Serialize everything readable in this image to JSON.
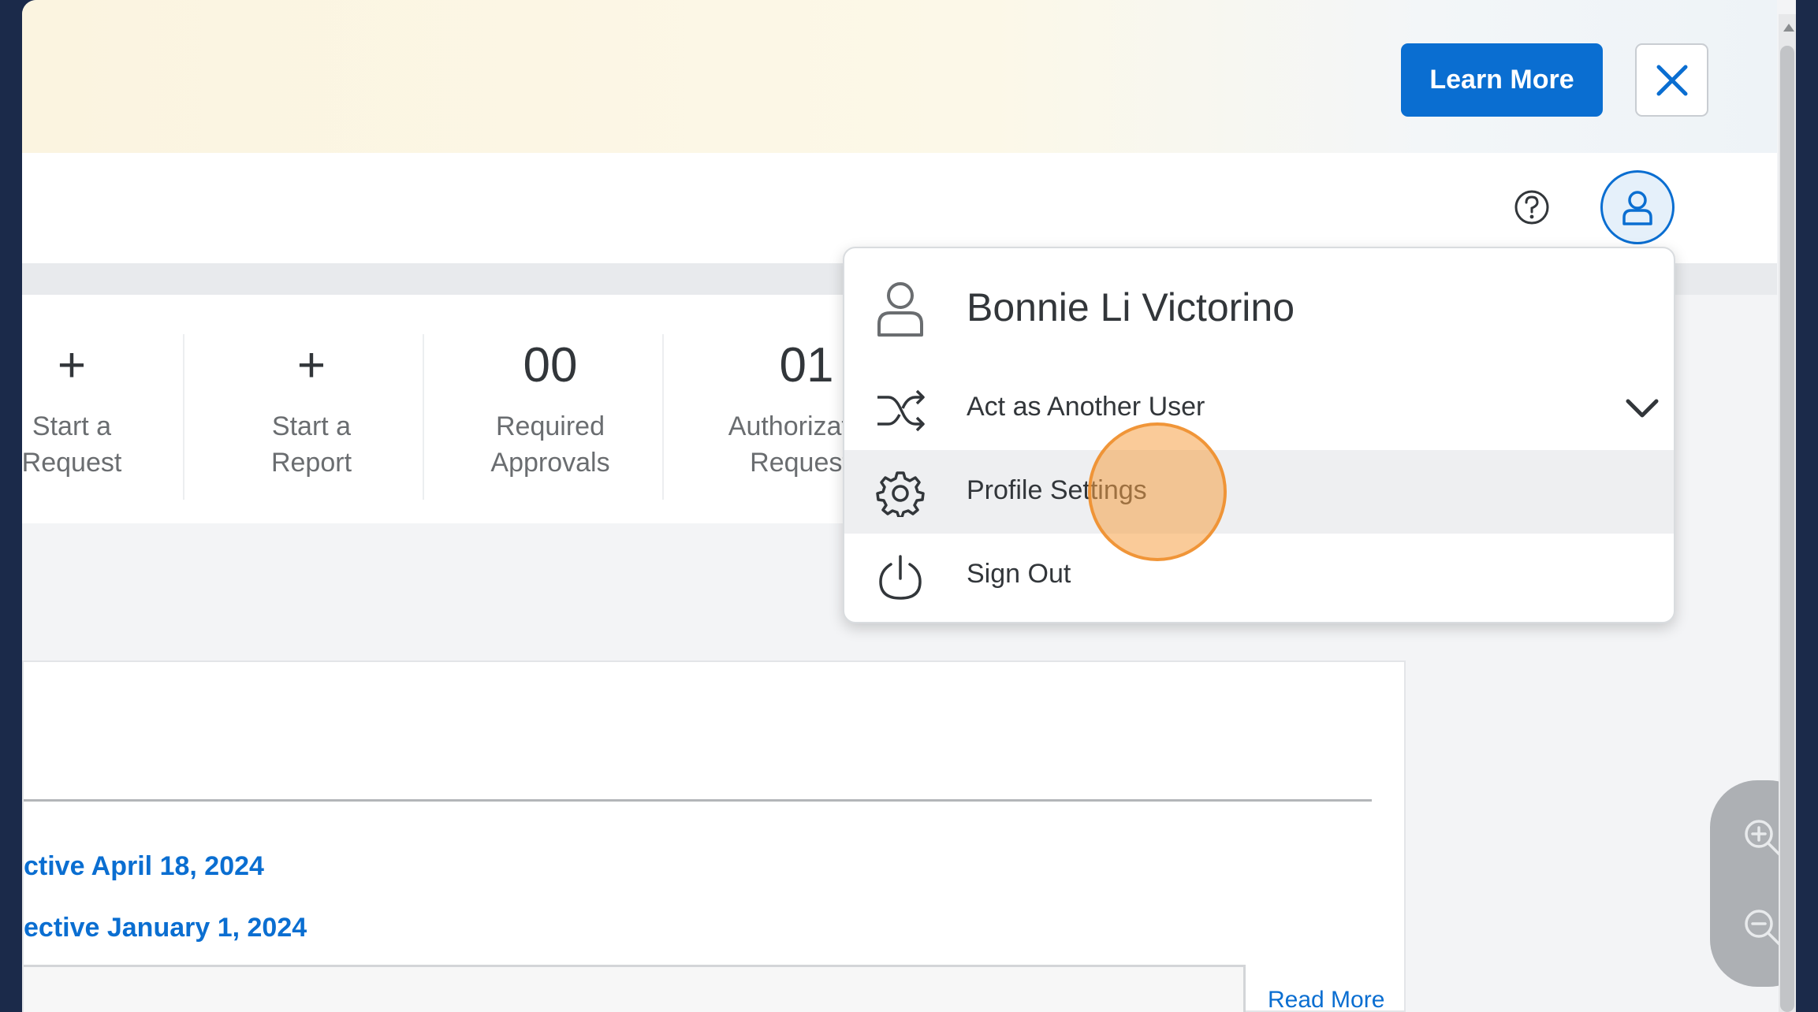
{
  "banner": {
    "learn_more_label": "Learn More"
  },
  "tiles": [
    {
      "top": "+",
      "line1": "Start a",
      "line2": "Request"
    },
    {
      "top": "+",
      "line1": "Start a",
      "line2": "Report"
    },
    {
      "top": "00",
      "line1": "Required",
      "line2": "Approvals"
    },
    {
      "top": "01",
      "line1": "Authorization",
      "line2": "Requests"
    }
  ],
  "card": {
    "link1": "ctive April 18, 2024",
    "link2": "ective January 1, 2024",
    "read_more": "Read More"
  },
  "user_menu": {
    "user_name": "Bonnie Li Victorino",
    "items": [
      {
        "label": "Act as Another User",
        "icon": "shuffle-icon"
      },
      {
        "label": "Profile Settings",
        "icon": "gear-icon"
      },
      {
        "label": "Sign Out",
        "icon": "power-icon"
      }
    ]
  },
  "colors": {
    "accent": "#0a6ed1",
    "click_marker": "#f5a046"
  }
}
